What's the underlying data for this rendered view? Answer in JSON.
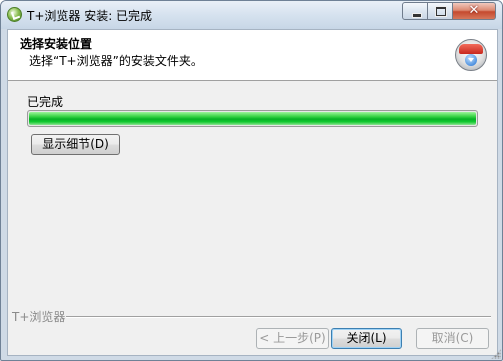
{
  "window": {
    "title": "T+浏览器 安装: 已完成",
    "icon": "tplus-browser-icon"
  },
  "header": {
    "title": "选择安装位置",
    "subtitle": "选择“T+浏览器”的安装文件夹。",
    "icon": "installer-disk-icon"
  },
  "progress": {
    "status_label": "已完成",
    "value": 1.0,
    "color": "#06b025"
  },
  "buttons": {
    "show_details": "显示细节(D)",
    "back": "< 上一步(P)",
    "close": "关闭(L)",
    "cancel": "取消(C)"
  },
  "branding": {
    "text": "T+浏览器"
  }
}
